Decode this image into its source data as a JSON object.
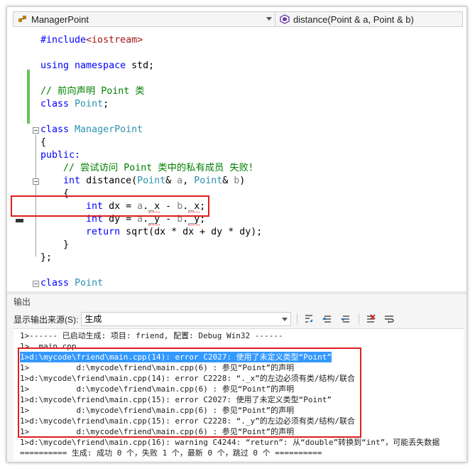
{
  "navbar": {
    "scope_combo": "ManagerPoint",
    "member_combo": "distance(Point & a, Point & b)"
  },
  "code": {
    "include_kw": "#include",
    "include_arg": "<iostream>",
    "using_line_kw": "using namespace",
    "using_line_rest": " std;",
    "comment_forward": "// 前向声明 Point 类",
    "class_kw": "class",
    "point_fwd_rest": ";",
    "class_name_point": "Point",
    "class_name_manager": "ManagerPoint",
    "brace_open": "{",
    "public_label": "public:",
    "comment_try": "// 尝试访问 Point 类中的私有成员 失败！",
    "int_kw": "int",
    "distance_name": " distance(",
    "amp_a": "& ",
    "param_a": "a",
    "comma": ", ",
    "amp_b": "& ",
    "param_b": "b",
    "close_paren": ")",
    "dx_decl": " dx = ",
    "member_x": "_x",
    "minus": " - ",
    "dot": ".",
    "semicolon": ";",
    "dy_decl": " dy = ",
    "member_y": "_y",
    "return_kw": "return",
    "return_rest": " sqrt(dx * dx + dy * dy);",
    "brace_close": "}",
    "brace_close_semi": "};"
  },
  "output": {
    "title": "输出",
    "source_label": "显示输出来源(S):",
    "source_value": "生成",
    "lines": [
      "1>------ 已启动生成: 项目: friend, 配置: Debug Win32 ------",
      "1>  main.cpp",
      "1>d:\\mycode\\friend\\main.cpp(14): error C2027: 使用了未定义类型“Point”",
      "1>          d:\\mycode\\friend\\main.cpp(6) : 参见“Point”的声明",
      "1>d:\\mycode\\friend\\main.cpp(14): error C2228: “._x”的左边必须有类/结构/联合",
      "1>          d:\\mycode\\friend\\main.cpp(6) : 参见“Point”的声明",
      "1>d:\\mycode\\friend\\main.cpp(15): error C2027: 使用了未定义类型“Point”",
      "1>          d:\\mycode\\friend\\main.cpp(6) : 参见“Point”的声明",
      "1>d:\\mycode\\friend\\main.cpp(15): error C2228: “._y”的左边必须有类/结构/联合",
      "1>          d:\\mycode\\friend\\main.cpp(6) : 参见“Point”的声明",
      "1>d:\\mycode\\friend\\main.cpp(16): warning C4244: “return”: 从“double”转换到“int”，可能丢失数据",
      "========== 生成: 成功 0 个，失败 1 个，最新 0 个，跳过 0 个 =========="
    ]
  },
  "icons": [
    "class-scope-icon",
    "method-icon",
    "find-in-output-icon",
    "prev-message-icon",
    "next-message-icon",
    "clear-all-icon",
    "word-wrap-icon"
  ],
  "colors": {
    "keyword": "#0000ff",
    "type": "#2b91af",
    "comment": "#008000",
    "string": "#a31515",
    "highlight_box": "#e01e1e",
    "selection": "#3399ff",
    "changed_bar": "#6cc05b"
  }
}
